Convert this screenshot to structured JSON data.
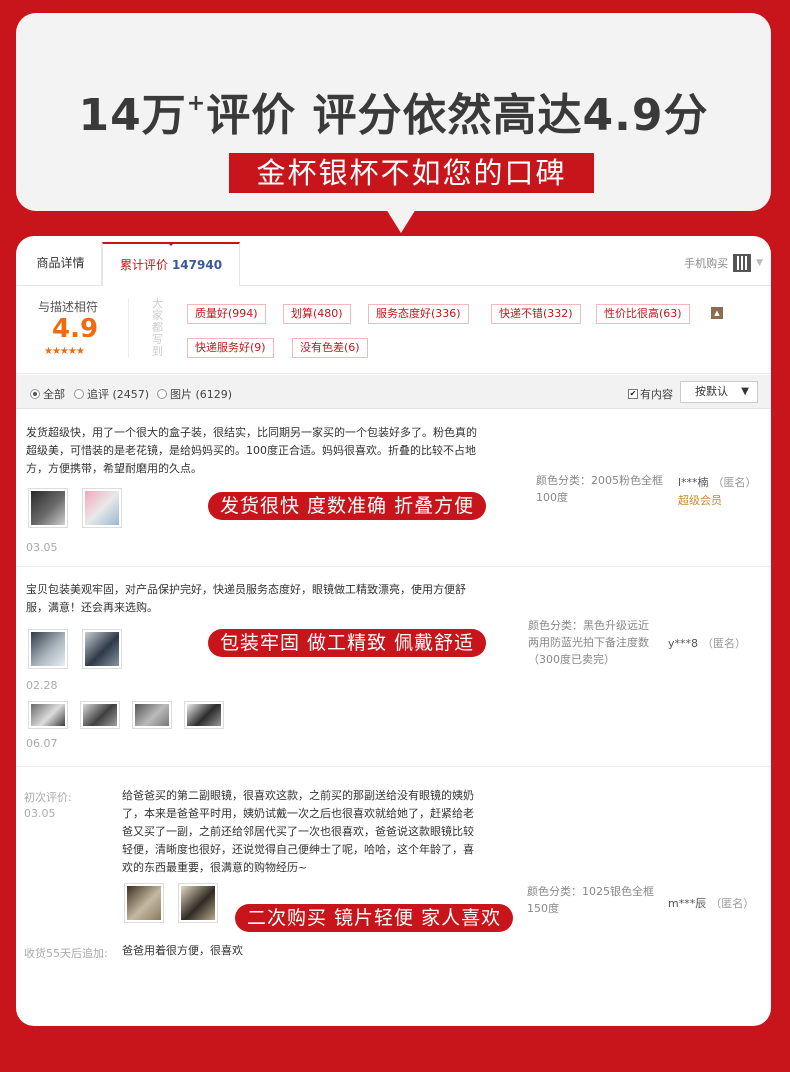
{
  "header": {
    "headline_part1": "14万",
    "headline_plus": "+",
    "headline_part2": "评价 评分依然高达4.9分",
    "subtitle": "金杯银杯不如您的口碑"
  },
  "tabs": {
    "details": "商品详情",
    "reviews_label": "累计评价",
    "reviews_count": "147940",
    "mobile_buy": "手机购买"
  },
  "summary": {
    "match_label": "与描述相符",
    "score": "4.9",
    "stars": "★★★★★",
    "side_label": "大家都写到",
    "tags": [
      "质量好(994)",
      "划算(480)",
      "服务态度好(336)",
      "快递不错(332)",
      "性价比很高(63)",
      "快递服务好(9)",
      "没有色差(6)"
    ]
  },
  "filter": {
    "all": "全部",
    "followup": "追评 (2457)",
    "pictures": "图片 (6129)",
    "has_content": "有内容",
    "sort": "按默认"
  },
  "reviews": [
    {
      "text_lines": [
        "发货超级快，用了一个很大的盒子装，很结实，比同期另一家买的一个包装好多了。粉色真的",
        "超级美，可惜装的是老花镜，是给妈妈买的。100度正合适。妈妈很喜欢。折叠的比较不占地",
        "方，方便携带，希望耐磨用的久点。"
      ],
      "date": "03.05",
      "sku_lines": [
        "颜色分类：2005粉色全框",
        "100度"
      ],
      "user": "l***楠",
      "anon": "（匿名）",
      "vip": "超级会员",
      "banner": "发货很快 度数准确 折叠方便"
    },
    {
      "text_lines": [
        "宝贝包装美观牢固，对产品保护完好，快递员服务态度好，眼镜做工精致漂亮，使用方便舒",
        "服，满意！还会再来选购。"
      ],
      "date": "02.28",
      "date2": "06.07",
      "sku_lines": [
        "颜色分类：黑色升级远近",
        "两用防蓝光拍下备注度数",
        "（300度已卖完）"
      ],
      "user": "y***8",
      "anon": "（匿名）",
      "banner": "包装牢固 做工精致 佩戴舒适"
    },
    {
      "initial_label": "初次评价:",
      "initial_date": "03.05",
      "text_lines": [
        "给爸爸买的第二副眼镜，很喜欢这款，之前买的那副送给没有眼镜的姨奶",
        "了，本来是爸爸平时用，姨奶试戴一次之后也很喜欢就给她了，赶紧给老",
        "爸又买了一副，之前还给邻居代买了一次也很喜欢，爸爸说这款眼镜比较",
        "轻便，清晰度也很好，还说觉得自己便绅士了呢，哈哈，这个年龄了，喜",
        "欢的东西最重要，很满意的购物经历~"
      ],
      "sku_lines": [
        "颜色分类：1025银色全框",
        "150度"
      ],
      "user": "m***辰",
      "anon": "（匿名）",
      "banner": "二次购买 镜片轻便 家人喜欢",
      "followup_label": "收货55天后追加:",
      "followup_text": "爸爸用着很方便，很喜欢"
    }
  ],
  "colors": {
    "brand_red": "#c8151b",
    "score_orange": "#f06a0f",
    "tag_text": "#c8151b"
  }
}
